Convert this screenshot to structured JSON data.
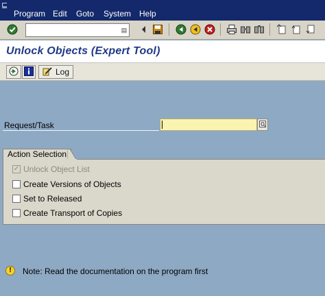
{
  "menubar": {
    "items": [
      "Program",
      "Edit",
      "Goto",
      "System",
      "Help"
    ]
  },
  "toolbar": {
    "icons": [
      "enter-icon",
      "save-icon",
      "back-icon",
      "exit-icon",
      "cancel-icon",
      "print-icon",
      "find-icon",
      "find-next-icon",
      "first-page-icon",
      "previous-page-icon",
      "next-page-icon"
    ]
  },
  "title": "Unlock Objects (Expert Tool)",
  "app_toolbar": {
    "log_label": "Log"
  },
  "request_task": {
    "label": "Request/Task",
    "value": ""
  },
  "action_selection": {
    "title": "Action Selection",
    "options": [
      {
        "label": "Unlock Object List",
        "checked": true,
        "disabled": true
      },
      {
        "label": "Create Versions of Objects",
        "checked": false,
        "disabled": false
      },
      {
        "label": "Set to Released",
        "checked": false,
        "disabled": false
      },
      {
        "label": "Create Transport of Copies",
        "checked": false,
        "disabled": false
      }
    ]
  },
  "note": {
    "icon": "!",
    "text": "Note: Read the documentation on the program first"
  },
  "colors": {
    "menubar": "#14296b",
    "title": "#1f3a86",
    "background": "#8ea9c3",
    "required_field": "#fbf3b0",
    "warning": "#f7d02c"
  }
}
